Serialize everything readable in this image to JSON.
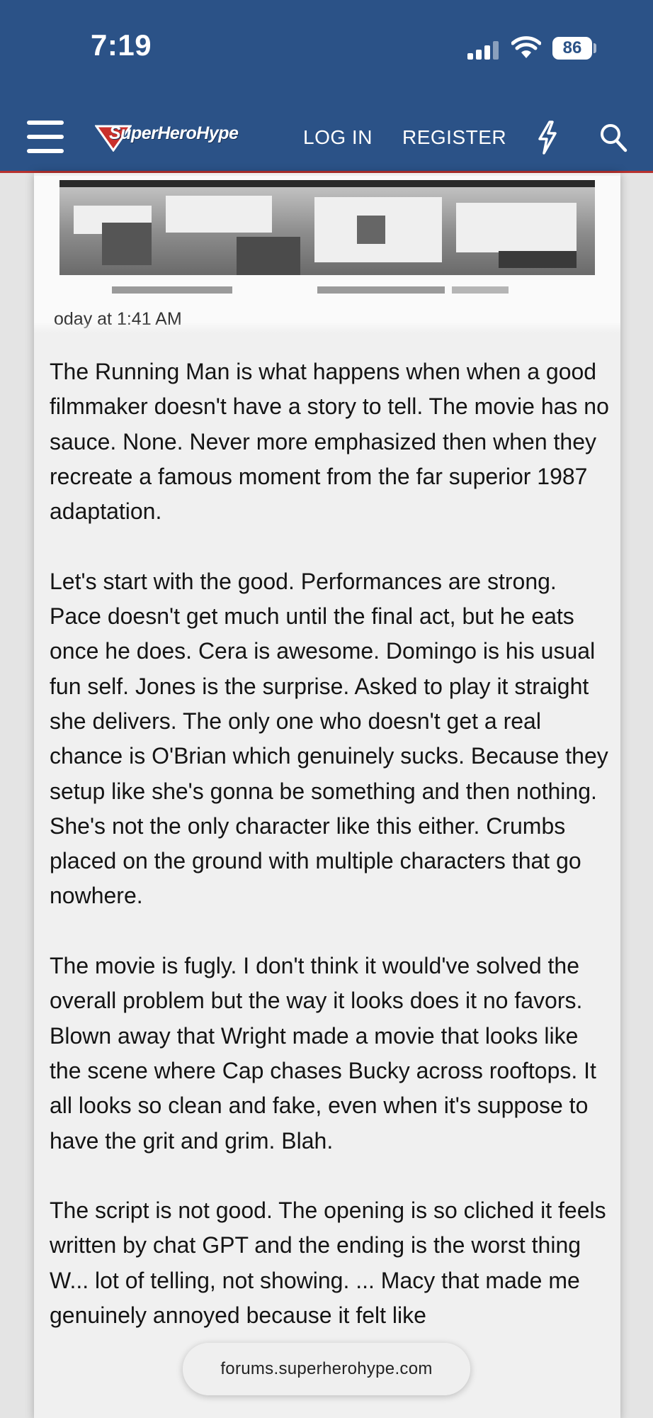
{
  "status_bar": {
    "time": "7:19",
    "battery": "86",
    "signal_icon": "cellular-signal-icon",
    "wifi_icon": "wifi-icon"
  },
  "nav": {
    "menu_icon": "hamburger-menu-icon",
    "logo_text": "SuperHeroHype",
    "login_label": "LOG IN",
    "register_label": "REGISTER",
    "bolt_icon": "lightning-bolt-icon",
    "search_icon": "search-icon",
    "colors": {
      "bar": "#2b5287",
      "accent": "#b8322f"
    }
  },
  "post": {
    "embed_caption": "oday at 1:41 AM",
    "paragraphs": [
      "The Running Man is what happens when when a good filmmaker doesn't have a story to tell. The movie has no sauce. None. Never more emphasized then when they recreate a famous moment from the far superior 1987 adaptation.",
      "Let's start with the good. Performances are strong. Pace doesn't get much until the final act, but he eats once he does. Cera is awesome. Domingo is his usual fun self. Jones is the surprise. Asked to play it straight she delivers. The only one who doesn't get a real chance is O'Brian which genuinely sucks. Because they setup like she's gonna be something and then nothing. She's not the only character like this either. Crumbs placed on the ground with multiple characters that go nowhere.",
      "The movie is fugly. I don't think it would've solved the overall problem but the way it looks does it no favors. Blown away that Wright made a movie that looks like the scene where Cap chases Bucky across rooftops. It all looks so clean and fake, even when it's suppose to have the grit and grim. Blah.",
      "The script is not good. The opening is so cliched it feels written by chat GPT and the ending is the worst thing W... lot of telling, not showing. ... Macy that made me genuinely annoyed because it felt like"
    ]
  },
  "browser": {
    "url": "forums.superherohype.com"
  }
}
